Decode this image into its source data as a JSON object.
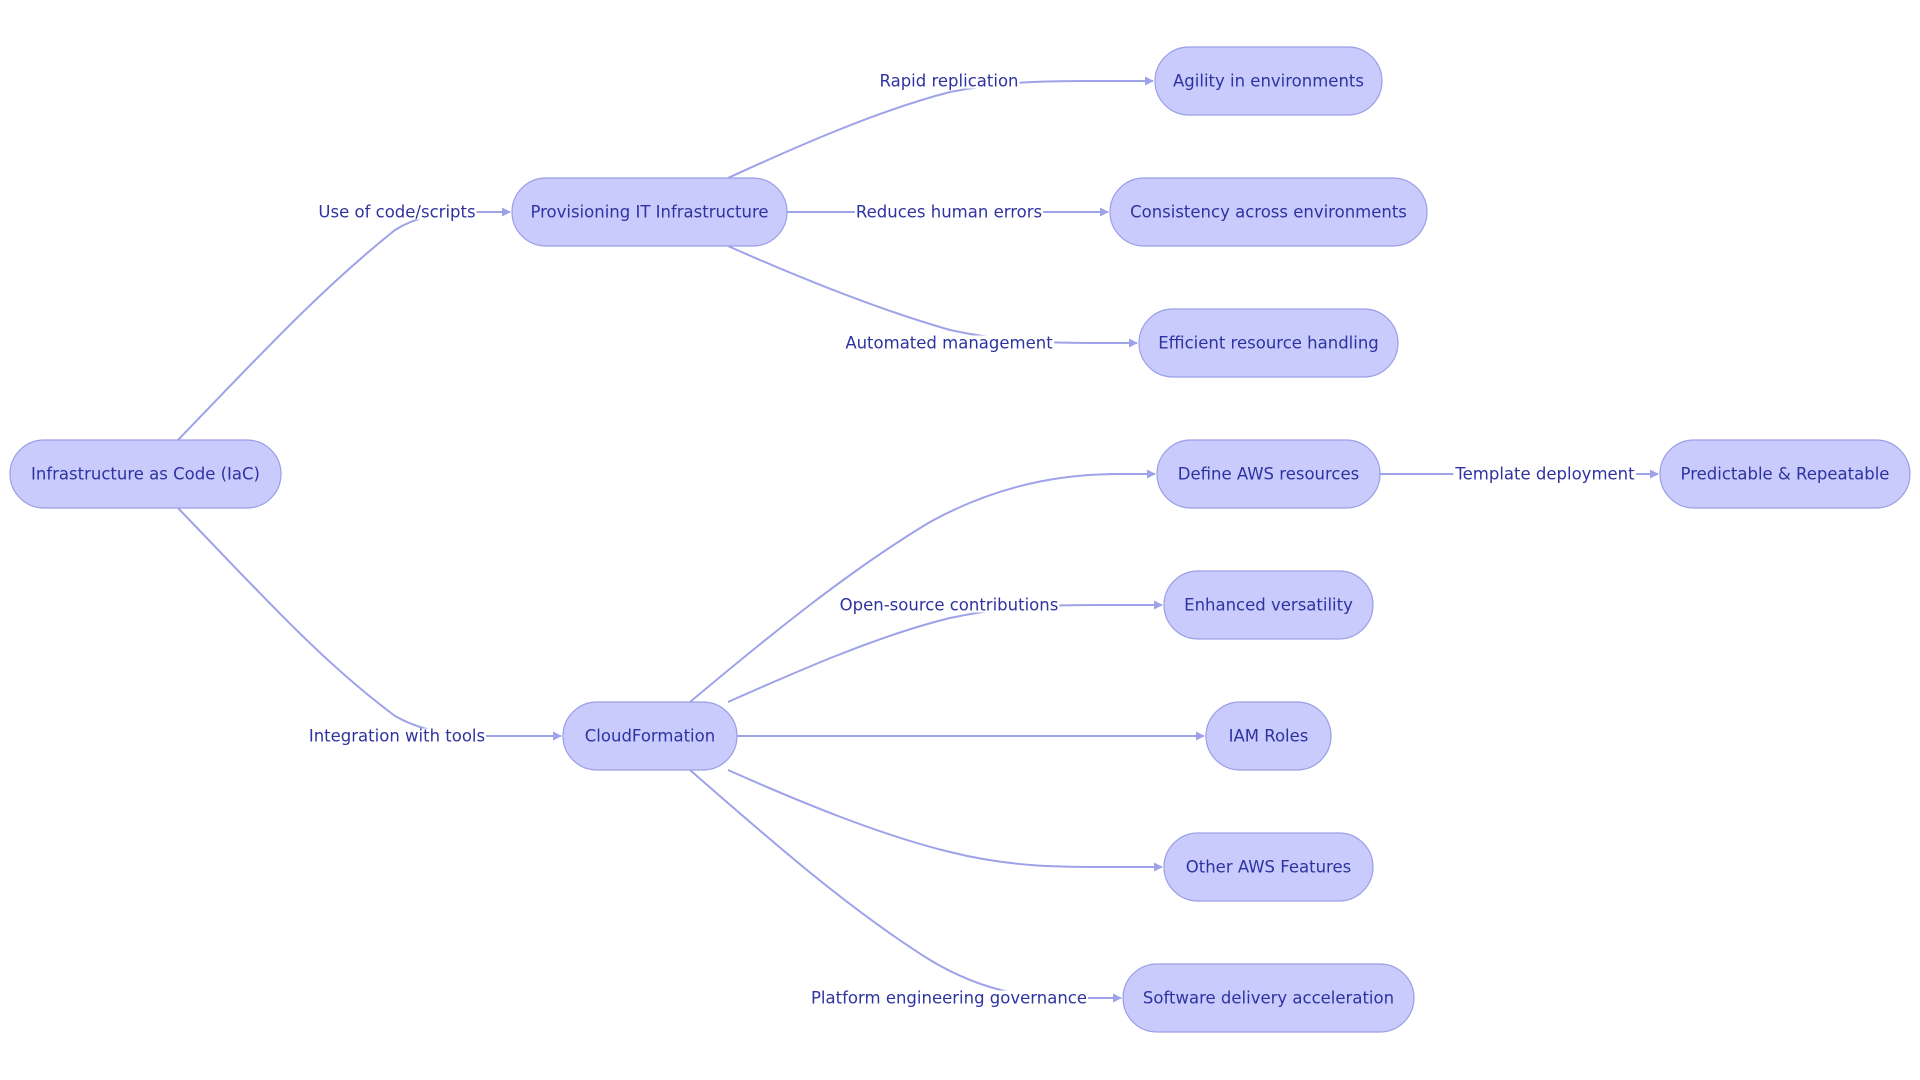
{
  "diagram": {
    "type": "flowchart",
    "direction": "left-to-right",
    "colors": {
      "node_fill": "#C8CBFC",
      "node_stroke": "#9B9FE6",
      "text": "#2E33A0",
      "edge": "#9EA2E8",
      "background": "#FFFFFF"
    },
    "nodes": [
      {
        "id": "iac",
        "label": "Infrastructure as Code (IaC)"
      },
      {
        "id": "prov",
        "label": "Provisioning IT Infrastructure"
      },
      {
        "id": "cf",
        "label": "CloudFormation"
      },
      {
        "id": "agility",
        "label": "Agility in environments"
      },
      {
        "id": "consistency",
        "label": "Consistency across environments"
      },
      {
        "id": "efficient",
        "label": "Efficient resource handling"
      },
      {
        "id": "define",
        "label": "Define AWS resources"
      },
      {
        "id": "predictable",
        "label": "Predictable & Repeatable"
      },
      {
        "id": "enhanced",
        "label": "Enhanced versatility"
      },
      {
        "id": "iam",
        "label": "IAM Roles"
      },
      {
        "id": "other",
        "label": "Other AWS Features"
      },
      {
        "id": "software",
        "label": "Software delivery acceleration"
      }
    ],
    "edges": [
      {
        "from": "iac",
        "to": "prov",
        "label": "Use of code/scripts"
      },
      {
        "from": "iac",
        "to": "cf",
        "label": "Integration with tools"
      },
      {
        "from": "prov",
        "to": "agility",
        "label": "Rapid replication"
      },
      {
        "from": "prov",
        "to": "consistency",
        "label": "Reduces human errors"
      },
      {
        "from": "prov",
        "to": "efficient",
        "label": "Automated management"
      },
      {
        "from": "cf",
        "to": "define",
        "label": ""
      },
      {
        "from": "define",
        "to": "predictable",
        "label": "Template deployment"
      },
      {
        "from": "cf",
        "to": "enhanced",
        "label": "Open-source contributions"
      },
      {
        "from": "cf",
        "to": "iam",
        "label": ""
      },
      {
        "from": "cf",
        "to": "other",
        "label": ""
      },
      {
        "from": "cf",
        "to": "software",
        "label": "Platform engineering governance"
      }
    ]
  }
}
